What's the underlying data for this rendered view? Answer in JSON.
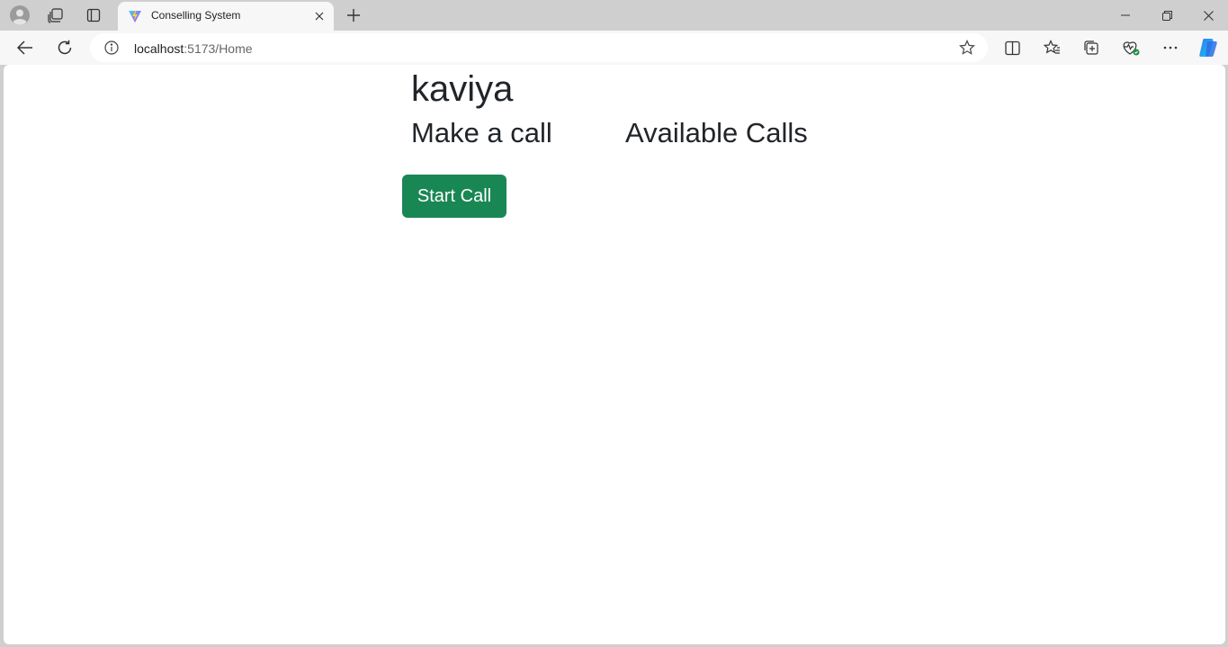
{
  "browser": {
    "tab": {
      "title": "Conselling System"
    },
    "address": {
      "host": "localhost",
      "path": ":5173/Home"
    },
    "icons": {
      "profile": "profile-icon",
      "workspaces": "workspaces-icon",
      "tab_actions": "tab-actions-icon",
      "favicon": "vite-favicon-icon",
      "close": "close-icon",
      "new_tab": "plus-icon",
      "back": "back-arrow-icon",
      "refresh": "refresh-icon",
      "info": "info-icon",
      "favorite": "star-icon",
      "split": "split-screen-icon",
      "favorites": "favorites-icon",
      "collections": "collections-icon",
      "browser_essentials": "heart-pulse-icon",
      "more": "more-icon",
      "copilot": "copilot-icon"
    }
  },
  "page": {
    "username": "kaviya",
    "nav": {
      "make_call": "Make a call",
      "available_calls": "Available Calls"
    },
    "start_call_label": "Start Call",
    "colors": {
      "primary_button": "#198754",
      "text": "#212529"
    }
  }
}
